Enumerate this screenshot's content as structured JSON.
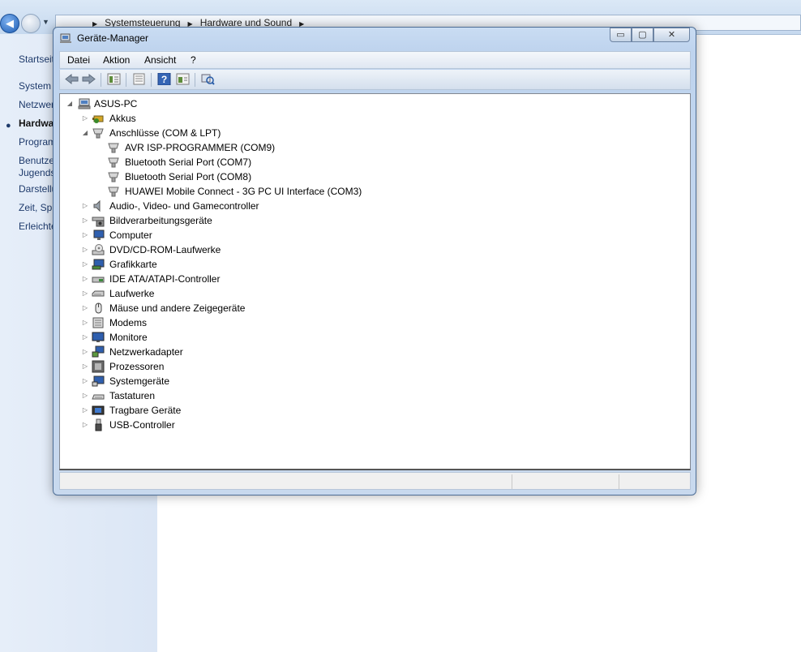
{
  "background": {
    "breadcrumb": [
      "Systemsteuerung",
      "Hardware und Sound"
    ],
    "sidebar_links": [
      "Startseit",
      "System",
      "Netzwer",
      "Hardwa",
      "Program",
      "Benutze",
      "Jugends",
      "Darstellu",
      "Zeit, Spr",
      "Erleichte"
    ],
    "active_link_index": 3
  },
  "window": {
    "title": "Geräte-Manager",
    "caption_buttons": {
      "minimize": "▭",
      "maximize": "▢",
      "close": "✕"
    }
  },
  "menubar": [
    "Datei",
    "Aktion",
    "Ansicht",
    "?"
  ],
  "toolbar": [
    "back-icon",
    "forward-icon",
    "properties-list-icon",
    "details-icon",
    "help-icon",
    "view-icon",
    "scan-hardware-icon"
  ],
  "tree": {
    "root": {
      "label": "ASUS-PC",
      "expanded": true,
      "icon": "computer-icon"
    },
    "categories": [
      {
        "label": "Akkus",
        "icon": "battery-icon",
        "expanded": false
      },
      {
        "label": "Anschlüsse (COM & LPT)",
        "icon": "port-icon",
        "expanded": true,
        "children": [
          {
            "label": "AVR ISP-PROGRAMMER (COM9)",
            "icon": "port-icon"
          },
          {
            "label": "Bluetooth Serial Port (COM7)",
            "icon": "port-icon"
          },
          {
            "label": "Bluetooth Serial Port (COM8)",
            "icon": "port-icon"
          },
          {
            "label": "HUAWEI Mobile Connect - 3G PC UI Interface (COM3)",
            "icon": "port-icon"
          }
        ]
      },
      {
        "label": "Audio-, Video- und Gamecontroller",
        "icon": "speaker-icon",
        "expanded": false
      },
      {
        "label": "Bildverarbeitungsgeräte",
        "icon": "camera-icon",
        "expanded": false
      },
      {
        "label": "Computer",
        "icon": "monitor-icon",
        "expanded": false
      },
      {
        "label": "DVD/CD-ROM-Laufwerke",
        "icon": "disc-drive-icon",
        "expanded": false
      },
      {
        "label": "Grafikkarte",
        "icon": "display-adapter-icon",
        "expanded": false
      },
      {
        "label": "IDE ATA/ATAPI-Controller",
        "icon": "ide-controller-icon",
        "expanded": false
      },
      {
        "label": "Laufwerke",
        "icon": "drive-icon",
        "expanded": false
      },
      {
        "label": "Mäuse und andere Zeigegeräte",
        "icon": "mouse-icon",
        "expanded": false
      },
      {
        "label": "Modems",
        "icon": "modem-icon",
        "expanded": false
      },
      {
        "label": "Monitore",
        "icon": "monitor-icon",
        "expanded": false
      },
      {
        "label": "Netzwerkadapter",
        "icon": "network-icon",
        "expanded": false
      },
      {
        "label": "Prozessoren",
        "icon": "cpu-icon",
        "expanded": false
      },
      {
        "label": "Systemgeräte",
        "icon": "system-device-icon",
        "expanded": false
      },
      {
        "label": "Tastaturen",
        "icon": "keyboard-icon",
        "expanded": false
      },
      {
        "label": "Tragbare Geräte",
        "icon": "portable-device-icon",
        "expanded": false
      },
      {
        "label": "USB-Controller",
        "icon": "usb-icon",
        "expanded": false
      }
    ]
  }
}
